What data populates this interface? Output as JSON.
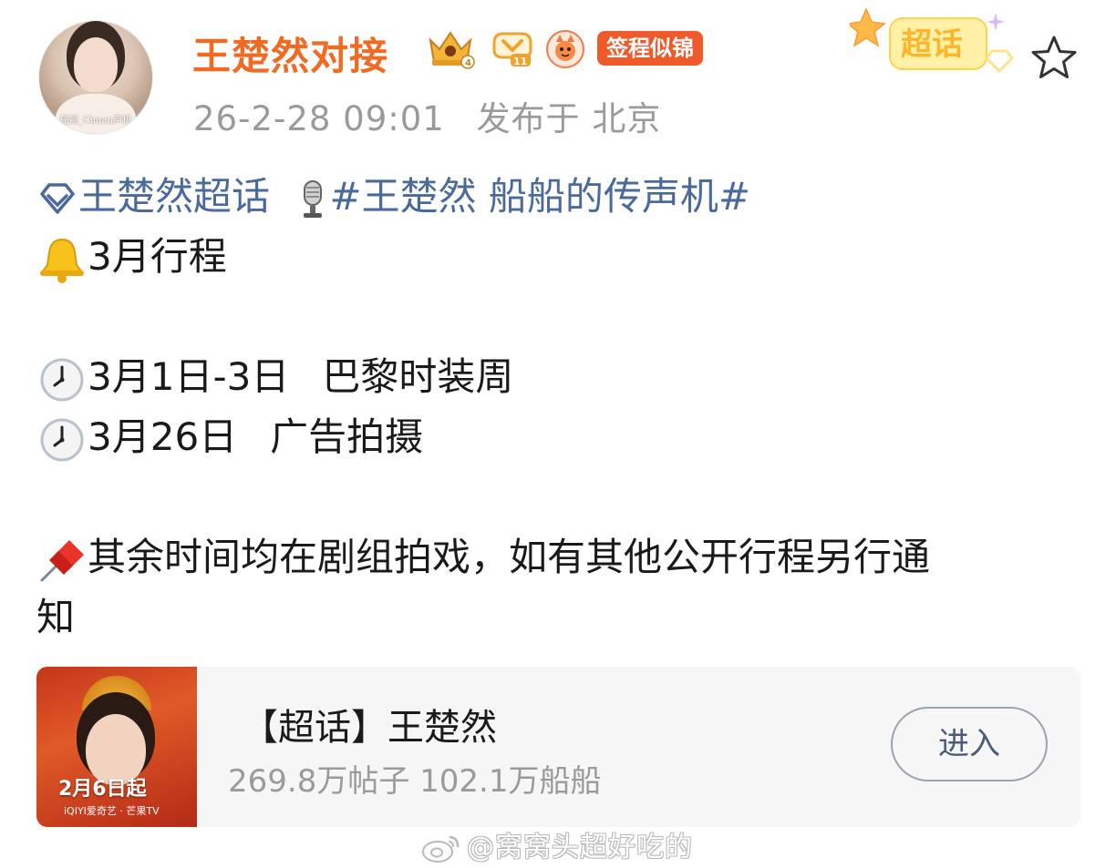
{
  "post": {
    "author": {
      "name": "王楚然对接",
      "avatar_caption": "船船_Chuan声机",
      "sign_badge": "签程似锦"
    },
    "meta": {
      "time": "26-2-28 09:01",
      "location": "发布于 北京"
    },
    "supertopic_badge_label": "超话",
    "content": {
      "topic_link": "王楚然超话",
      "hashtag": "#王楚然 船船的传声机#",
      "heading": "3月行程",
      "schedule": [
        {
          "date": "3月1日-3日",
          "event": "巴黎时装周"
        },
        {
          "date": "3月26日",
          "event": "广告拍摄"
        }
      ],
      "note": "其余时间均在剧组拍戏，如有其他公开行程另行通",
      "note_cont": "知"
    },
    "card": {
      "title": "【超话】王楚然",
      "stats": "269.8万帖子 102.1万船船",
      "button_label": "进入",
      "thumb_date": "2月6日起",
      "thumb_brand": "iQIYI爱奇艺 · 芒果TV"
    }
  },
  "watermark": "@窝窝头超好吃的",
  "colors": {
    "username": "#f06a21",
    "link": "#4a6a9b",
    "meta": "#9a9a9a",
    "sign_badge_bg": "#ef5a2b",
    "card_bg": "#f6f6f6"
  }
}
